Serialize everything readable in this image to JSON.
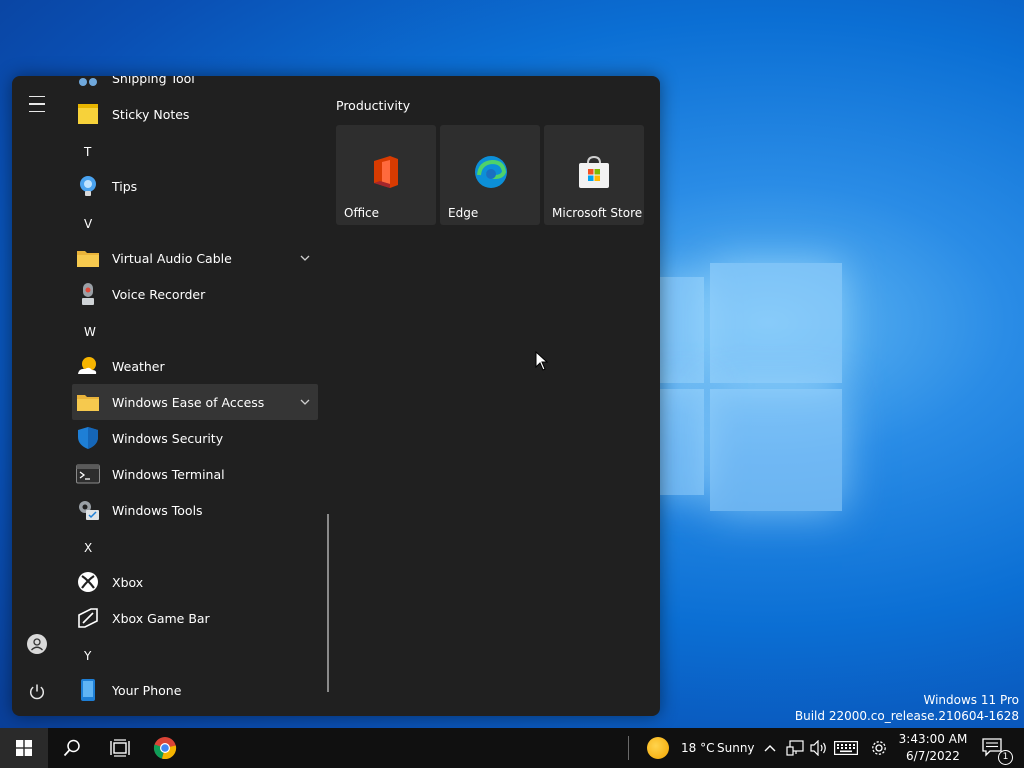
{
  "desktop": {
    "watermark_line1": "Windows 11 Pro",
    "watermark_line2": "Build 22000.co_release.210604-1628"
  },
  "start_menu": {
    "partial_top_item": "Snipping Tool",
    "apps": [
      {
        "label": "Sticky Notes",
        "icon": "sticky-notes-icon"
      },
      {
        "letter": "T"
      },
      {
        "label": "Tips",
        "icon": "tips-icon"
      },
      {
        "letter": "V"
      },
      {
        "label": "Virtual Audio Cable",
        "icon": "folder-icon",
        "expandable": true
      },
      {
        "label": "Voice Recorder",
        "icon": "voice-recorder-icon"
      },
      {
        "letter": "W"
      },
      {
        "label": "Weather",
        "icon": "weather-icon"
      },
      {
        "label": "Windows Ease of Access",
        "icon": "folder-icon",
        "expandable": true,
        "selected": true
      },
      {
        "label": "Windows Security",
        "icon": "windows-security-icon"
      },
      {
        "label": "Windows Terminal",
        "icon": "terminal-icon"
      },
      {
        "label": "Windows Tools",
        "icon": "windows-tools-icon"
      },
      {
        "letter": "X"
      },
      {
        "label": "Xbox",
        "icon": "xbox-icon"
      },
      {
        "label": "Xbox Game Bar",
        "icon": "xbox-game-bar-icon"
      },
      {
        "letter": "Y"
      },
      {
        "label": "Your Phone",
        "icon": "your-phone-icon"
      }
    ],
    "group": {
      "title": "Productivity",
      "tiles": [
        {
          "label": "Office",
          "icon": "office-icon"
        },
        {
          "label": "Edge",
          "icon": "edge-icon"
        },
        {
          "label": "Microsoft Store",
          "icon": "microsoft-store-icon"
        }
      ]
    }
  },
  "taskbar": {
    "weather_temp": "18 °C",
    "weather_condition": "Sunny",
    "time": "3:43:00 AM",
    "date": "6/7/2022",
    "notification_count": "1"
  },
  "colors": {
    "start_bg": "#202020",
    "tile_bg": "#2e2e2e",
    "taskbar_bg": "#101010",
    "selected_row": "#353535"
  }
}
